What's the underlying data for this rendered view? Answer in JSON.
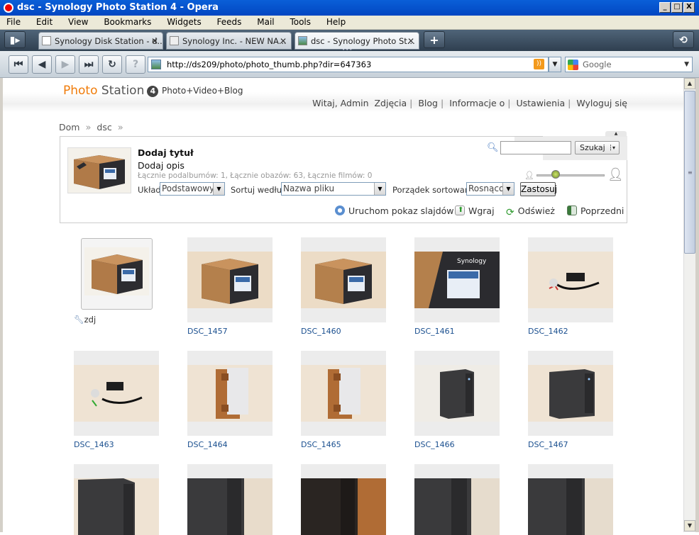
{
  "window": {
    "title": "dsc - Synology Photo Station 4 - Opera",
    "controls": [
      "_",
      "□",
      "X"
    ]
  },
  "menu": [
    "File",
    "Edit",
    "View",
    "Bookmarks",
    "Widgets",
    "Feeds",
    "Mail",
    "Tools",
    "Help"
  ],
  "tabs": [
    {
      "label": "Synology Disk Station - d...",
      "close": "✕"
    },
    {
      "label": "Synology Inc. - NEW NA...",
      "close": "✕"
    },
    {
      "label": "dsc - Synology Photo St...",
      "close": "✕"
    }
  ],
  "tab_new": "+",
  "tab_more": "•••",
  "address": {
    "url": "http://ds209/photo/photo_thumb.php?dir=647363",
    "search_engine": "Google"
  },
  "header": {
    "logo_photo": "Photo",
    "logo_station": " Station",
    "logo_version": "4",
    "tagline": "Photo+Video+Blog"
  },
  "topnav": {
    "welcome": "Witaj, Admin",
    "items": [
      "Zdjęcia",
      "Blog",
      "Informacje o",
      "Ustawienia",
      "Wyloguj się"
    ]
  },
  "breadcrumb": {
    "home": "Dom",
    "current": "dsc",
    "sep": "»"
  },
  "album": {
    "title": "Dodaj tytuł",
    "description": "Dodaj opis",
    "stats": "Łącznie podalbumów: 1, Łącznie obazów: 63, Łącznie filmów: 0",
    "layout_label": "Układ",
    "layout_value": "Podstawowy",
    "sort_label": "Sortuj według",
    "sort_value": "Nazwa pliku",
    "order_label": "Porządek sortowania",
    "order_value": "Rosnąco",
    "apply": "Zastosuj",
    "search_button": "Szukaj",
    "actions": {
      "slideshow": "Uruchom pokaz slajdów",
      "upload": "Wgraj",
      "refresh": "Odśwież",
      "previous": "Poprzedni"
    }
  },
  "gallery": {
    "subalbum": "zdj",
    "photos": [
      "DSC_1457",
      "DSC_1460",
      "DSC_1461",
      "DSC_1462",
      "DSC_1463",
      "DSC_1464",
      "DSC_1465",
      "DSC_1466",
      "DSC_1467"
    ]
  },
  "colors": {
    "accent_orange": "#f07c0a",
    "link_blue": "#1a4f8f",
    "titlebar_blue": "#0a5fd8"
  }
}
